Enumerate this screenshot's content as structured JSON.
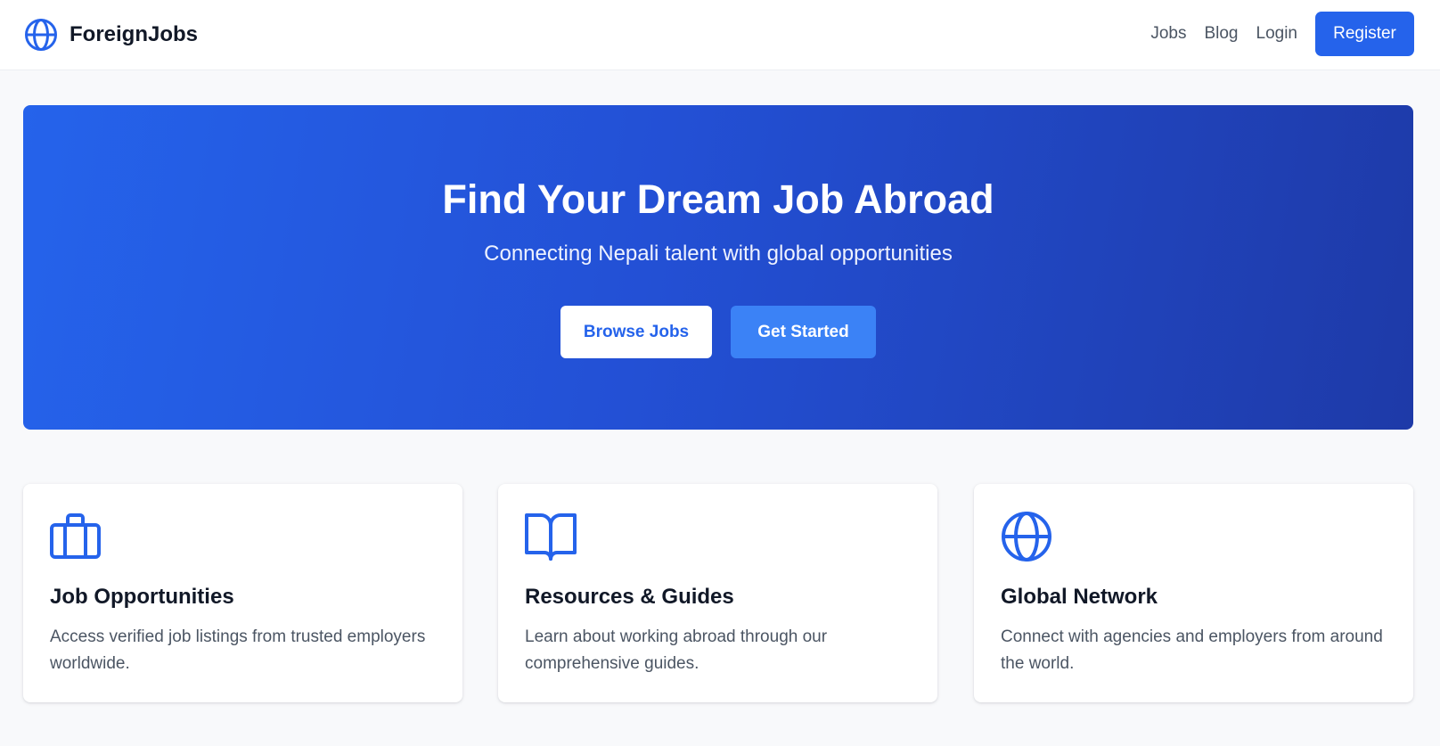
{
  "header": {
    "brand": "ForeignJobs",
    "logo_icon": "globe-icon",
    "nav": [
      "Jobs",
      "Blog",
      "Login"
    ],
    "register_label": "Register"
  },
  "hero": {
    "title": "Find Your Dream Job Abroad",
    "subtitle": "Connecting Nepali talent with global opportunities",
    "primary_button": "Browse Jobs",
    "secondary_button": "Get Started"
  },
  "features": [
    {
      "icon": "briefcase-icon",
      "title": "Job Opportunities",
      "text": "Access verified job listings from trusted employers worldwide."
    },
    {
      "icon": "book-open-icon",
      "title": "Resources & Guides",
      "text": "Learn about working abroad through our comprehensive guides."
    },
    {
      "icon": "globe-icon",
      "title": "Global Network",
      "text": "Connect with agencies and employers from around the world."
    }
  ],
  "colors": {
    "accent": "#2563eb",
    "accent_light": "#3b82f6",
    "hero_gradient_end": "#1e3aa8",
    "page_background": "#f8f9fb",
    "body_text": "#4b5563"
  }
}
